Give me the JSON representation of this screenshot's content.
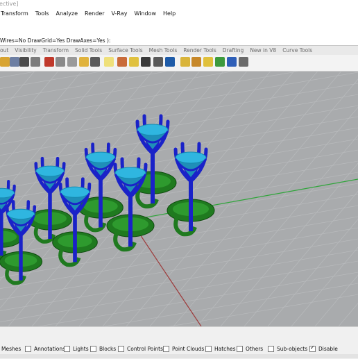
{
  "titlebar": {
    "text": "ective]"
  },
  "menu": [
    "Transform",
    "Tools",
    "Analyze",
    "Render",
    "V-Ray",
    "Window",
    "Help"
  ],
  "command_line": {
    "text": "Wires=No  DrawGrid=Yes  DrawAxes=Yes ):"
  },
  "tabs": [
    "out",
    "Visibility",
    "Transform",
    "Solid Tools",
    "Surface Tools",
    "Mesh Tools",
    "Render Tools",
    "Drafting",
    "New in V8",
    "Curve Tools"
  ],
  "osnaps": [
    {
      "label": "Meshes",
      "checked": false,
      "show_box": false
    },
    {
      "label": "Annotations",
      "checked": false,
      "show_box": true
    },
    {
      "label": "Lights",
      "checked": false,
      "show_box": true
    },
    {
      "label": "Blocks",
      "checked": false,
      "show_box": true
    },
    {
      "label": "Control Points",
      "checked": false,
      "show_box": true
    },
    {
      "label": "Point Clouds",
      "checked": false,
      "show_box": true
    },
    {
      "label": "Hatches",
      "checked": false,
      "show_box": true
    },
    {
      "label": "Others",
      "checked": false,
      "show_box": true
    },
    {
      "label": "Sub-objects",
      "checked": false,
      "show_box": true
    },
    {
      "label": "Disable",
      "checked": true,
      "show_box": true
    }
  ],
  "colors": {
    "viewport_bg": "#a9abad",
    "grid_line": "#b9bbbd",
    "x_axis": "#9e3b3b",
    "y_axis": "#2fa53a",
    "prong_blue": "#1a22c8",
    "gem_cyan": "#2fb6e0",
    "gallery_green": "#1f7a1f"
  }
}
